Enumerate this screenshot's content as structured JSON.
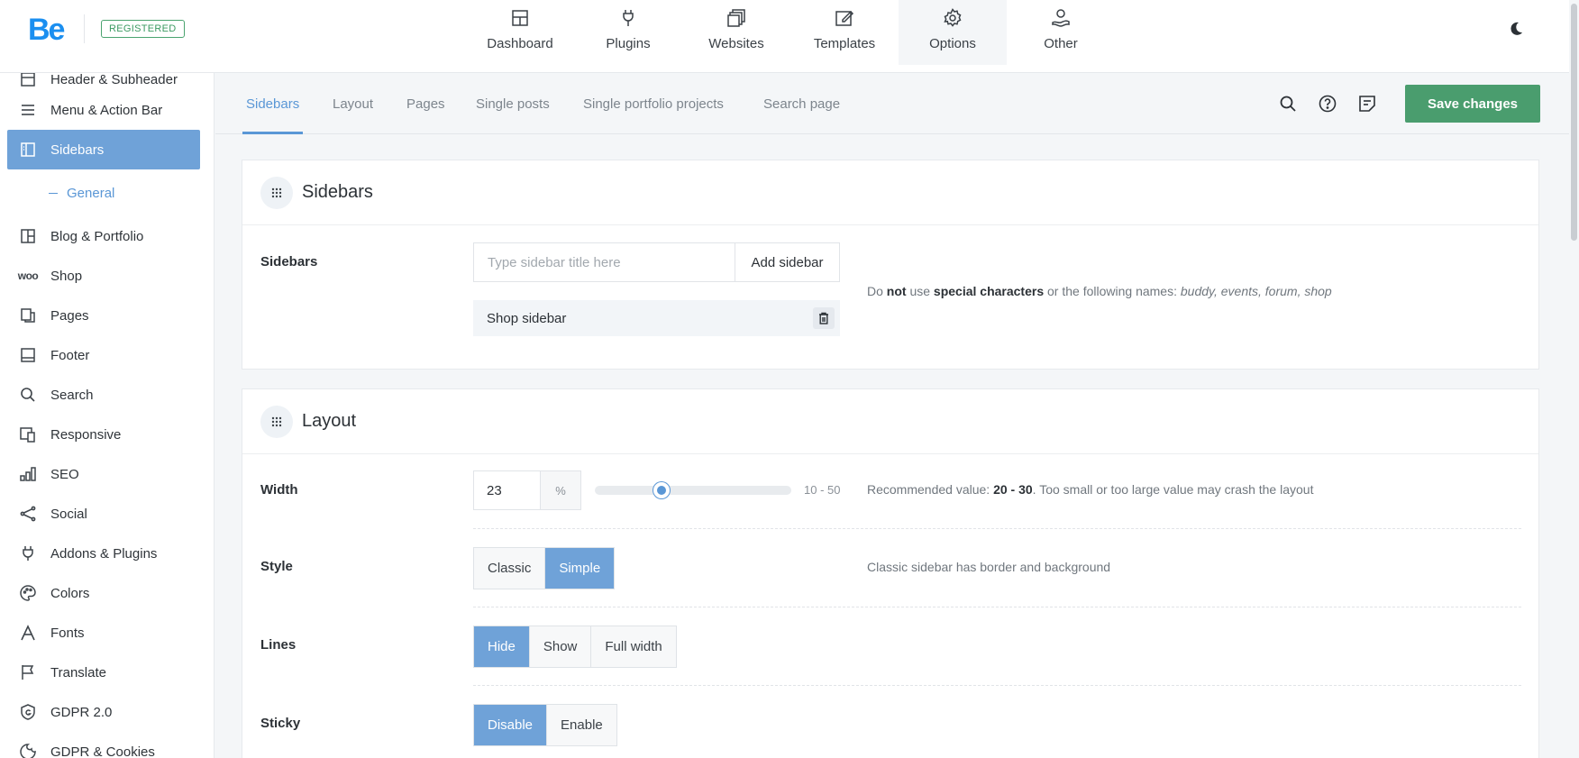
{
  "brand": {
    "logo": "Be",
    "badge": "REGISTERED"
  },
  "topnav": [
    {
      "label": "Dashboard",
      "icon": "dashboard-icon"
    },
    {
      "label": "Plugins",
      "icon": "plug-icon"
    },
    {
      "label": "Websites",
      "icon": "websites-icon"
    },
    {
      "label": "Templates",
      "icon": "templates-icon"
    },
    {
      "label": "Options",
      "icon": "gear-icon",
      "active": true
    },
    {
      "label": "Other",
      "icon": "other-icon"
    }
  ],
  "sidebar": {
    "items": [
      {
        "label": "Header & Subheader",
        "icon": "header-icon"
      },
      {
        "label": "Menu & Action Bar",
        "icon": "menu-icon"
      },
      {
        "label": "Sidebars",
        "icon": "sidebar-icon",
        "active": true
      },
      {
        "label": "Blog & Portfolio",
        "icon": "blog-icon"
      },
      {
        "label": "Shop",
        "icon": "woo-icon"
      },
      {
        "label": "Pages",
        "icon": "pages-icon"
      },
      {
        "label": "Footer",
        "icon": "footer-icon"
      },
      {
        "label": "Search",
        "icon": "search-icon"
      },
      {
        "label": "Responsive",
        "icon": "responsive-icon"
      },
      {
        "label": "SEO",
        "icon": "seo-icon"
      },
      {
        "label": "Social",
        "icon": "share-icon"
      },
      {
        "label": "Addons & Plugins",
        "icon": "plug-icon"
      },
      {
        "label": "Colors",
        "icon": "palette-icon"
      },
      {
        "label": "Fonts",
        "icon": "font-icon"
      },
      {
        "label": "Translate",
        "icon": "flag-icon"
      },
      {
        "label": "GDPR 2.0",
        "icon": "shield-icon"
      },
      {
        "label": "GDPR & Cookies",
        "icon": "cookie-icon"
      }
    ],
    "sub_item": "General",
    "woo_text": "woo"
  },
  "subtabs": [
    "Sidebars",
    "Layout",
    "Pages",
    "Single posts",
    "Single portfolio projects",
    "Search page"
  ],
  "toolbar": {
    "save_label": "Save changes"
  },
  "sidebars_panel": {
    "title": "Sidebars",
    "field_label": "Sidebars",
    "input_placeholder": "Type sidebar title here",
    "add_label": "Add sidebar",
    "existing": [
      "Shop sidebar"
    ],
    "hint_1": "Do",
    "hint_not": "not",
    "hint_2": "use",
    "hint_special": "special characters",
    "hint_3": "or the following names:",
    "hint_names": "buddy, events, forum, shop"
  },
  "layout_panel": {
    "title": "Layout",
    "width": {
      "label": "Width",
      "value": "23",
      "unit": "%",
      "range": "10 - 50",
      "min": 10,
      "max": 50,
      "hint_1": "Recommended value:",
      "hint_value": "20 - 30",
      "hint_2": ". Too small or too large value may crash the layout"
    },
    "style": {
      "label": "Style",
      "options": [
        "Classic",
        "Simple"
      ],
      "selected": "Simple",
      "hint": "Classic sidebar has border and background"
    },
    "lines": {
      "label": "Lines",
      "options": [
        "Hide",
        "Show",
        "Full width"
      ],
      "selected": "Hide"
    },
    "sticky": {
      "label": "Sticky",
      "options": [
        "Disable",
        "Enable"
      ],
      "selected": "Disable"
    }
  },
  "colors": {
    "accent": "#5a97d6",
    "active_bg": "#6fa2d8",
    "save": "#4a9d6e",
    "brand": "#1b8ff0"
  }
}
